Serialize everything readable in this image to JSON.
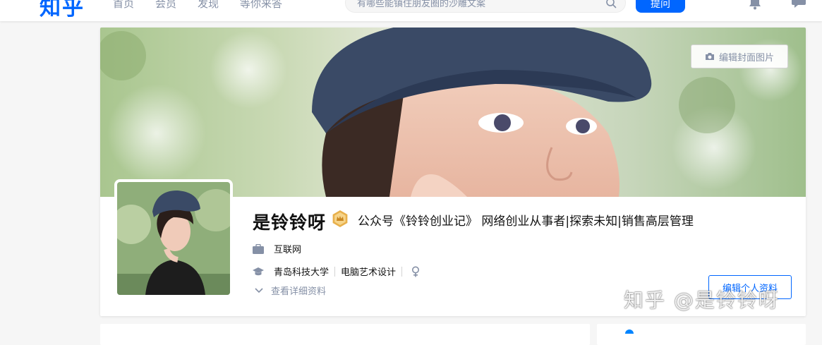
{
  "header": {
    "logo": "知乎",
    "nav": [
      "首页",
      "会员",
      "发现",
      "等你来答"
    ],
    "search": {
      "placeholder": "有哪些能镇住朋友圈的沙雕文案"
    },
    "ask_label": "提问",
    "icons": [
      "search-icon",
      "bell-icon",
      "message-icon"
    ]
  },
  "profile": {
    "cover": {
      "edit_label": "编辑封面图片",
      "icon": "camera-icon"
    },
    "name": "是铃铃呀",
    "badge_icon": "badge-icon",
    "headline": "公众号《铃铃创业记》 网络创业从事者|探索未知|销售高层管理",
    "industry": "互联网",
    "school": "青岛科技大学",
    "major": "电脑艺术设计",
    "gender_icon": "female-icon",
    "details_label": "查看详细资料",
    "edit_profile_label": "编辑个人资料"
  },
  "watermark": "知乎 @是铃铃呀",
  "colors": {
    "accent": "#0066ff",
    "muted": "#8590a6",
    "badge": "#e8b04b"
  }
}
